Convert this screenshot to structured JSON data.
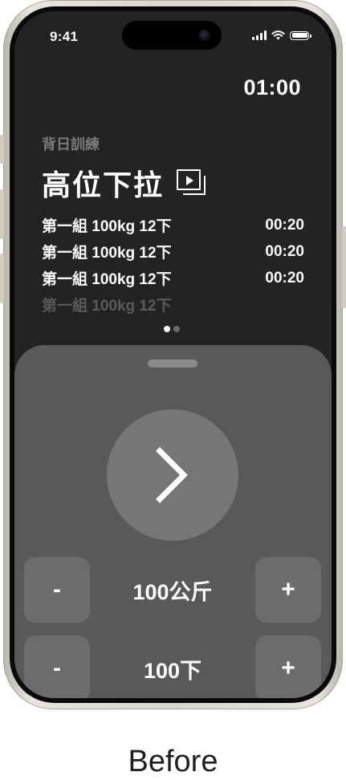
{
  "status_bar": {
    "time": "9:41"
  },
  "header": {
    "timer": "01:00"
  },
  "workout": {
    "category": "背日訓練",
    "exercise_title": "高位下拉",
    "video_icon": "video-play-icon",
    "sets": [
      {
        "label": "第一組 100kg 12下",
        "time": "00:20"
      },
      {
        "label": "第一組 100kg 12下",
        "time": "00:20"
      },
      {
        "label": "第一組 100kg 12下",
        "time": "00:20"
      },
      {
        "label": "第一組 100kg 12下",
        "time": ""
      }
    ],
    "page_indicator": {
      "current": 1,
      "total": 2
    }
  },
  "controls": {
    "next_icon": "chevron-right-icon",
    "weight": {
      "minus_label": "-",
      "value": "100公斤",
      "plus_label": "+"
    },
    "reps": {
      "minus_label": "-",
      "value": "100下",
      "plus_label": "+"
    }
  },
  "caption": "Before"
}
